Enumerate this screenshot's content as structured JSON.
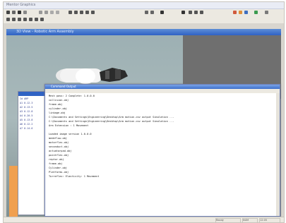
{
  "app": {
    "title": "Mentor Graphics"
  },
  "viewer": {
    "title": "3D View - Robotic Arm Assembly"
  },
  "editor": {
    "title": "Command Output",
    "lines": [
      "Mesh pass: 2 Complete: 1.0.0.0",
      "collision.obj",
      "frame.obj",
      "cylinder.obj",
      "linkage.obj",
      "C:\\Documents and Settings\\Engineering\\Desktop\\Arm  motion.csv  output  Simulation ...",
      "C:\\Documents and Settings\\Engineering\\Desktop\\Arm  motion.csv  output  Simulation ...",
      "Arm  Extension : 1 Movement",
      "",
      "Loaded image version  1.0.0.0",
      "medeflow.obj",
      "motorflex.obj",
      "seconduct.obj",
      "actuatorpad.obj",
      "pointflex.obj",
      "reptor.obj",
      "frame.obj",
      "Cylinder.obj",
      "Platforms.obj",
      "Torreflex: Elasticity: 1 Movement"
    ]
  },
  "console": {
    "lines": [
      "Id  ARP",
      "A1  0.12.3",
      "A2  0.13.5",
      "A3  0.12.8",
      "A4  0.20.5",
      "A5  0.13.8",
      "A6  0.12.2",
      "A7  0.14.6"
    ]
  },
  "status": {
    "cells": [
      "Ready",
      "NUM",
      "12:05"
    ]
  }
}
